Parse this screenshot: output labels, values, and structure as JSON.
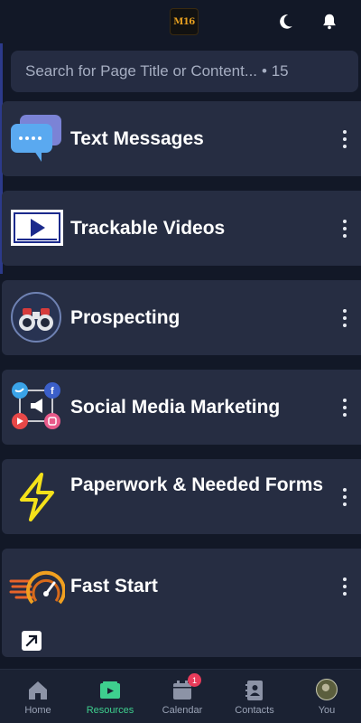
{
  "header": {
    "logo_text": "M16",
    "moon_icon": "moon-icon",
    "bell_icon": "bell-icon"
  },
  "search": {
    "placeholder": "Search for Page Title or Content...",
    "count_text": "• 15"
  },
  "cards": [
    {
      "title": "Text Messages",
      "icon": "chat-bubbles-icon"
    },
    {
      "title": "Trackable Videos",
      "icon": "video-play-icon"
    },
    {
      "title": "Prospecting",
      "icon": "binoculars-icon"
    },
    {
      "title": "Social Media Marketing",
      "icon": "social-network-icon"
    },
    {
      "title": "Paperwork & Needed Forms",
      "icon": "lightning-icon"
    },
    {
      "title": "Fast Start",
      "icon": "speedometer-icon"
    }
  ],
  "tabbar": {
    "items": [
      {
        "label": "Home",
        "icon": "home-icon"
      },
      {
        "label": "Resources",
        "icon": "resources-icon"
      },
      {
        "label": "Calendar",
        "icon": "calendar-icon",
        "badge": "1"
      },
      {
        "label": "Contacts",
        "icon": "contacts-icon"
      },
      {
        "label": "You",
        "icon": "avatar"
      }
    ],
    "active": "Resources"
  },
  "colors": {
    "background": "#121827",
    "card": "#262d42",
    "accent_active": "#3ecf8e",
    "badge": "#e83b5a"
  }
}
